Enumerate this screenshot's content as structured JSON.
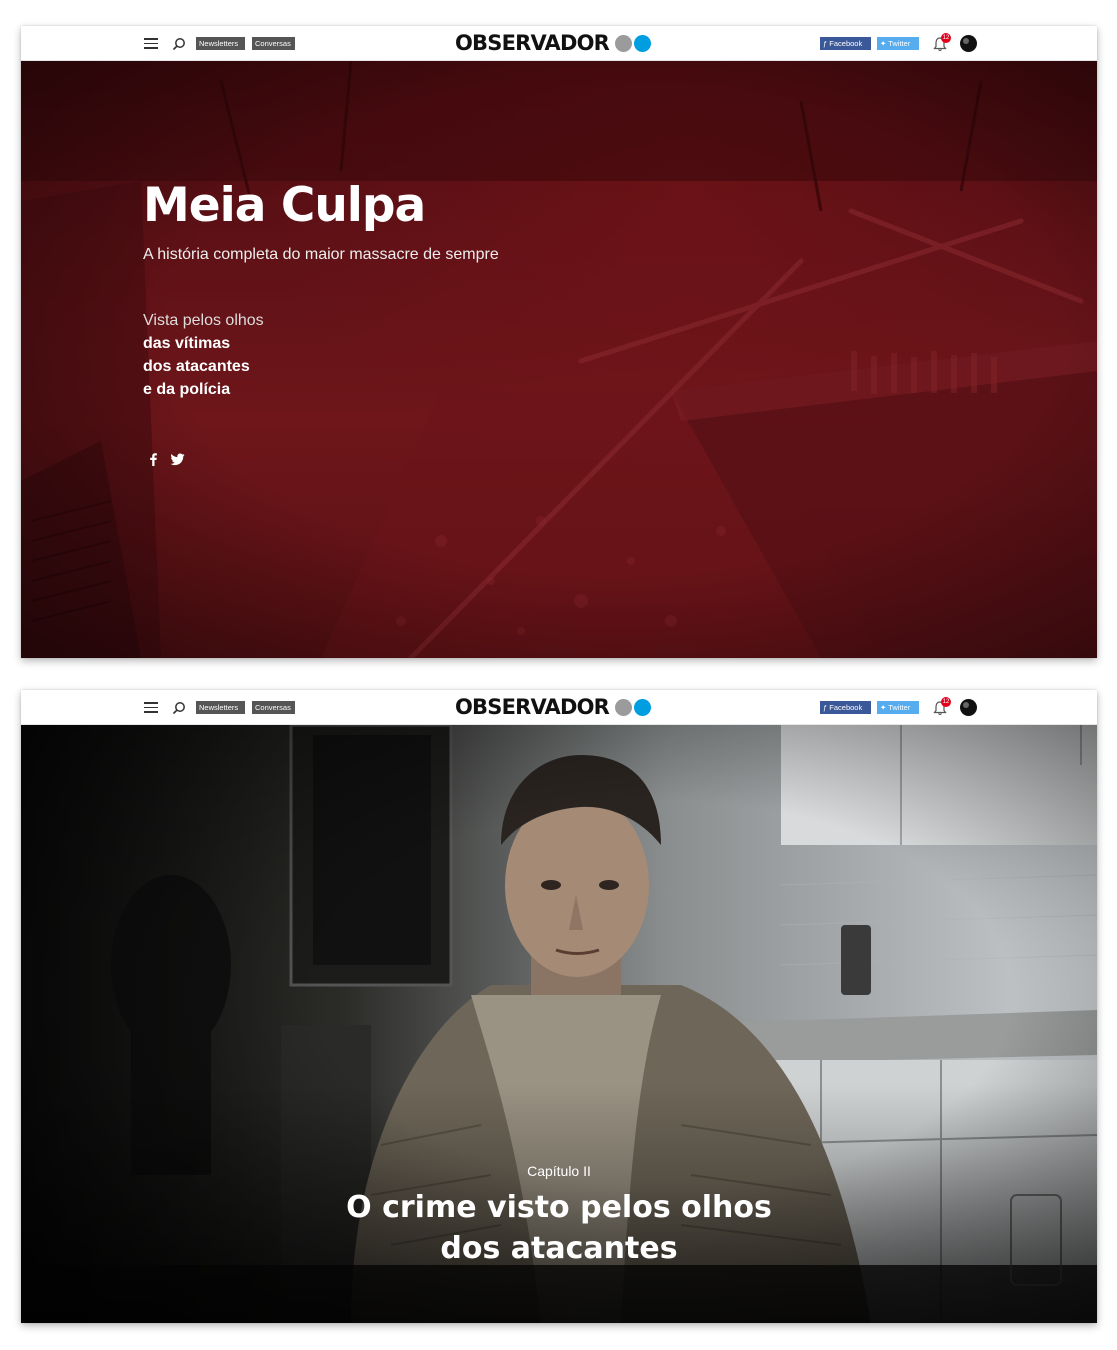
{
  "nav": {
    "newsletters_label": "Newsletters",
    "conversas_label": "Conversas",
    "brand": "OBSERVADOR",
    "facebook_label": "Facebook",
    "twitter_label": "Twitter",
    "notifications_count": "12",
    "icons": [
      "menu-icon",
      "search-icon",
      "bell-icon",
      "avatar"
    ]
  },
  "hero": {
    "title": "Meia Culpa",
    "subtitle": "A história completa do maior massacre de sempre",
    "intro": "Vista pelos olhos",
    "line1": "das vítimas",
    "line2": "dos atacantes",
    "line3": "e da polícia",
    "share_icons": [
      "facebook-icon",
      "twitter-icon"
    ]
  },
  "chapter": {
    "label": "Capítulo II",
    "title_line1": "O crime visto pelos olhos",
    "title_line2": "dos atacantes"
  },
  "colors": {
    "hero_tint": "#5e1116",
    "facebook": "#3b5998",
    "twitter": "#55acee",
    "brand_grey": "#9b9b9b",
    "brand_blue": "#009de0",
    "badge": "#e2001a"
  }
}
